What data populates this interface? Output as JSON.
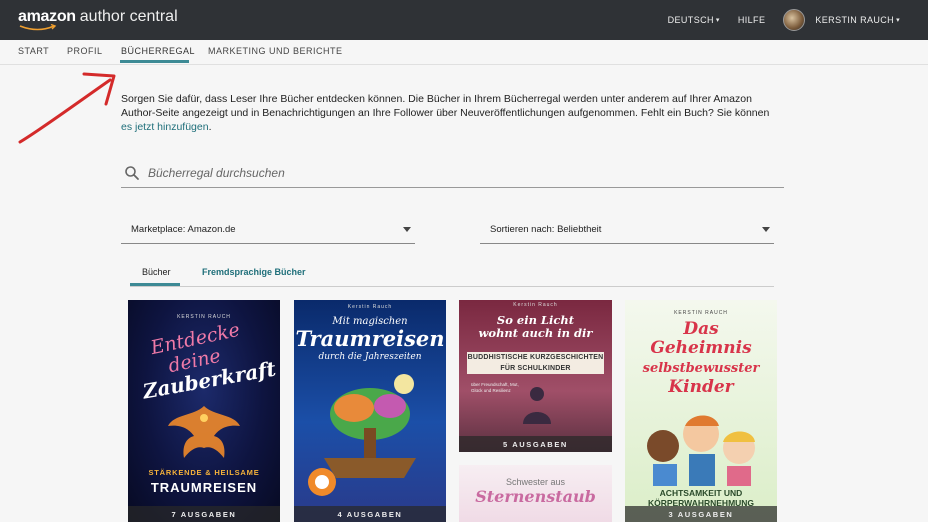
{
  "app": {
    "logo_brand": "amazon",
    "logo_product": "author central"
  },
  "topbar": {
    "language_label": "DEUTSCH",
    "help_label": "HILFE",
    "user_name": "KERSTIN RAUCH"
  },
  "nav": {
    "items": [
      "START",
      "PROFIL",
      "BÜCHERREGAL",
      "MARKETING UND BERICHTE"
    ],
    "active": "BÜCHERREGAL"
  },
  "intro": {
    "text": "Sorgen Sie dafür, dass Leser Ihre Bücher entdecken können. Die Bücher in Ihrem Bücherregal werden unter anderem auf Ihrer Amazon Author-Seite angezeigt und in Benachrichtigungen an Ihre Follower über Neuveröffentlichungen aufgenommen. Fehlt ein Buch? Sie können ",
    "link_text": "es jetzt hinzufügen",
    "suffix": "."
  },
  "search": {
    "placeholder": "Bücherregal durchsuchen"
  },
  "filters": {
    "marketplace_label": "Marketplace: Amazon.de",
    "sort_label": "Sortieren nach: Beliebtheit"
  },
  "tabs": {
    "books": "Bücher",
    "foreign": "Fremdsprachige Bücher"
  },
  "books": [
    {
      "author": "KERSTIN RAUCH",
      "title_line1": "Entdecke",
      "title_line2": "deine",
      "title_line3": "Zauberkraft",
      "subtitle": "STÄRKENDE & HEILSAME",
      "subtitle2": "TRAUMREISEN",
      "editions": "7 AUSGABEN"
    },
    {
      "author": "Kerstin Rauch",
      "title_line1": "Mit magischen",
      "title_line2": "Traumreisen",
      "title_line3": "durch die Jahreszeiten",
      "editions": "4 AUSGABEN"
    },
    {
      "author": "Kerstin Rauch",
      "title_line1": "So ein Licht",
      "title_line2": "wohnt auch in dir",
      "band_line1": "BUDDHISTISCHE KURZGESCHICHTEN",
      "band_line2": "FÜR SCHULKINDER",
      "small_line1": "über Freundschaft, Mut,",
      "small_line2": "Glück und Resilienz",
      "editions": "5 AUSGABEN"
    },
    {
      "title_line1": "Schwester aus",
      "title_line2": "Sternenstaub"
    },
    {
      "author": "KERSTIN RAUCH",
      "title_line1": "Das",
      "title_line2": "Geheimnis",
      "title_line3": "selbstbewusster",
      "title_line4": "Kinder",
      "subtitle": "ACHTSAMKEIT UND",
      "subtitle2": "KÖRPERWAHRNEHMUNG",
      "editions": "3 AUSGABEN"
    }
  ],
  "colors": {
    "topbar_bg": "#2f3236",
    "accent": "#3d8a95",
    "link": "#1f6f7a",
    "annotation_arrow": "#d42a2a"
  }
}
